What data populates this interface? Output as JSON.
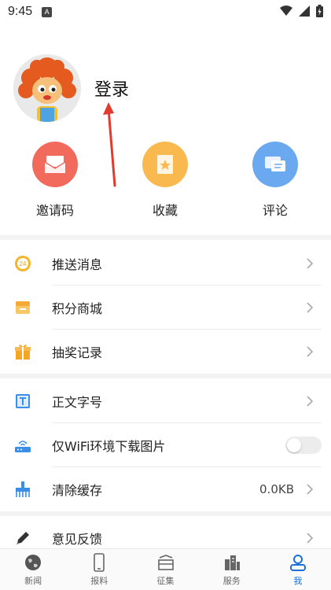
{
  "status": {
    "time": "9:45",
    "notif_badge": "A"
  },
  "profile": {
    "login_label": "登录"
  },
  "quick": [
    {
      "label": "邀请码",
      "icon": "invite-envelope-icon",
      "color": "#f26a5b"
    },
    {
      "label": "收藏",
      "icon": "favorite-bookmark-icon",
      "color": "#f9b94f"
    },
    {
      "label": "评论",
      "icon": "comment-bubble-icon",
      "color": "#6aa9ef"
    }
  ],
  "menu": [
    {
      "label": "推送消息",
      "icon": "push-24-icon"
    },
    {
      "label": "积分商城",
      "icon": "points-mall-icon"
    },
    {
      "label": "抽奖记录",
      "icon": "lottery-gift-icon"
    },
    {
      "label": "正文字号",
      "icon": "font-size-icon"
    },
    {
      "label": "仅WiFi环境下载图片",
      "icon": "wifi-router-icon",
      "toggle": false
    },
    {
      "label": "清除缓存",
      "icon": "clear-cache-icon",
      "value": "0.0KB"
    },
    {
      "label": "意见反馈",
      "icon": "feedback-pencil-icon"
    }
  ],
  "tabs": [
    {
      "label": "新闻",
      "icon": "globe-icon"
    },
    {
      "label": "报料",
      "icon": "phone-icon"
    },
    {
      "label": "征集",
      "icon": "collect-tray-icon"
    },
    {
      "label": "服务",
      "icon": "buildings-icon"
    },
    {
      "label": "我",
      "icon": "user-icon",
      "active": true
    }
  ],
  "colors": {
    "accent": "#1b6fd6",
    "arrow": "#e23b2e"
  }
}
